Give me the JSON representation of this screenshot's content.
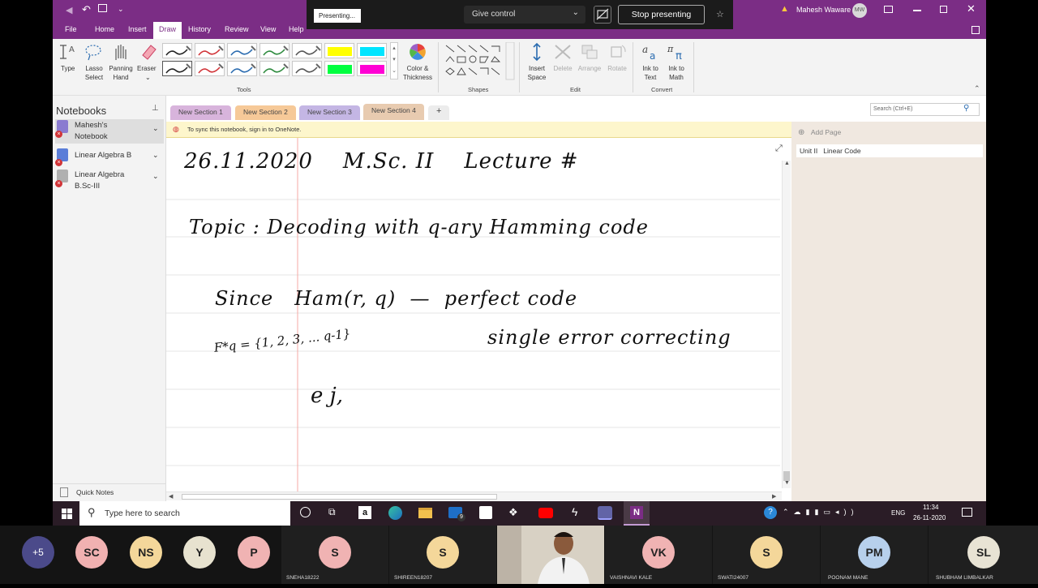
{
  "presentation": {
    "presenting_label": "Presenting...",
    "give_control_label": "Give control",
    "stop_presenting_label": "Stop presenting"
  },
  "titlebar": {
    "user_name": "Mahesh Waware",
    "user_initials": "MW"
  },
  "menu": {
    "items": [
      "File",
      "Home",
      "Insert",
      "Draw",
      "History",
      "Review",
      "View",
      "Help"
    ],
    "active": "Draw"
  },
  "ribbon": {
    "type_label": "Type",
    "lasso_label": "Lasso Select",
    "panning_label": "Panning Hand",
    "eraser_label": "Eraser",
    "tools_group": "Tools",
    "color_thickness_label": "Color & Thickness",
    "shapes_group": "Shapes",
    "insert_space_label": "Insert Space",
    "delete_label": "Delete",
    "arrange_label": "Arrange",
    "rotate_label": "Rotate",
    "edit_group": "Edit",
    "ink_to_text_label": "Ink to Text",
    "ink_to_math_label": "Ink to Math",
    "convert_group": "Convert",
    "pen_colors": [
      "#222222",
      "#d13438",
      "#2b6cb0",
      "#2e8b3e",
      "#555555",
      "#222222",
      "#d13438",
      "#2b6cb0",
      "#2e8b3e",
      "#555555"
    ],
    "highlighter_colors": [
      "#ffff00",
      "#00e5ff",
      "#00ff40",
      "#ff00d4"
    ]
  },
  "sidebar": {
    "title": "Notebooks",
    "notebooks": [
      {
        "label": "Mahesh's Notebook",
        "color": "#8a7bd0"
      },
      {
        "label": "Linear Algebra B",
        "color": "#5b7ed8"
      },
      {
        "label": "Linear Algebra B.Sc-III",
        "color": "#b0b0b0"
      }
    ],
    "quick_notes": "Quick Notes"
  },
  "sections": {
    "tabs": [
      {
        "label": "New Section 1",
        "color": "#d8b4dc"
      },
      {
        "label": "New Section 2",
        "color": "#f6c998"
      },
      {
        "label": "New Section 3",
        "color": "#c4b6e4"
      },
      {
        "label": "New Section 4",
        "color": "#e8cbb0"
      }
    ],
    "add_tab": "+"
  },
  "search": {
    "placeholder": "Search (Ctrl+E)"
  },
  "sync_message": "To sync this notebook, sign in to OneNote.",
  "pages": {
    "add_page": "Add Page",
    "items": [
      "Unit II   Linear Code"
    ]
  },
  "ink": {
    "line1": "26.11.2020    M.Sc. II    Lecture #",
    "line2": "Topic : Decoding with q-ary Hamming code",
    "line3": "Since   Ham(r, q)  —  perfect code",
    "line4a": "F*q = {1, 2, 3, ... q-1}",
    "line4b": "single error correcting",
    "line5": "e j,"
  },
  "taskbar": {
    "search_placeholder": "Type here to search",
    "lang": "ENG",
    "time": "11:34",
    "date": "26-11-2020",
    "mail_badge": "9"
  },
  "meeting": {
    "overflow": "+5",
    "avatars": [
      {
        "initials": "SC",
        "color": "#f1b1b1"
      },
      {
        "initials": "NS",
        "color": "#f4d79a"
      },
      {
        "initials": "Y",
        "color": "#e7e2cf"
      },
      {
        "initials": "P",
        "color": "#f0b3b3"
      }
    ],
    "participants": [
      {
        "initials": "S",
        "name": "SNEHA18222",
        "color": "#f0b3b3"
      },
      {
        "initials": "S",
        "name": "SHIREEN18207",
        "color": "#f4d79a"
      },
      {
        "initials": "VK",
        "name": "VAISHNAVI KALE",
        "color": "#f0b3b3"
      },
      {
        "initials": "S",
        "name": "SWATI24007",
        "color": "#f4d79a"
      },
      {
        "initials": "PM",
        "name": "POONAM MANE",
        "color": "#b7d0ec"
      },
      {
        "initials": "SL",
        "name": "SHUBHAM LIMBALKAR",
        "color": "#e8e3d4"
      }
    ]
  }
}
